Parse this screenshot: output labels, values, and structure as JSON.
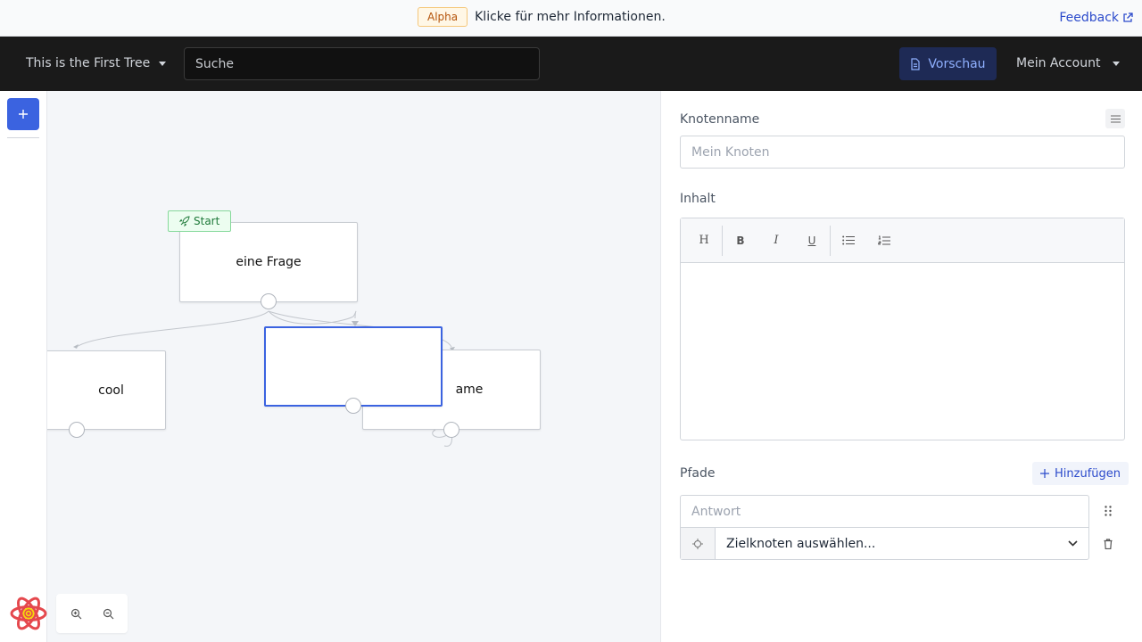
{
  "banner": {
    "badge": "Alpha",
    "text": "Klicke für mehr Informationen.",
    "feedback": "Feedback"
  },
  "header": {
    "tree_name": "This is the First Tree",
    "search_placeholder": "Suche",
    "preview_label": "Vorschau",
    "account_label": "Mein Account"
  },
  "canvas": {
    "start_label": "Start",
    "nodes": {
      "question": "eine Frage",
      "cool": "cool",
      "name_partial": "ame",
      "selected": ""
    }
  },
  "panel": {
    "node_name_label": "Knotenname",
    "node_name_placeholder": "Mein Knoten",
    "content_label": "Inhalt",
    "toolbar": {
      "heading": "H",
      "bold": "B",
      "italic": "I",
      "underline": "U"
    },
    "paths_label": "Pfade",
    "add_path_label": "Hinzufügen",
    "answer_placeholder": "Antwort",
    "target_select_label": "Zielknoten auswählen..."
  },
  "colors": {
    "accent": "#3b63e0",
    "header_bg": "#1a1a1a",
    "link": "#2b4acb",
    "start_green": "#1f7a3a"
  }
}
